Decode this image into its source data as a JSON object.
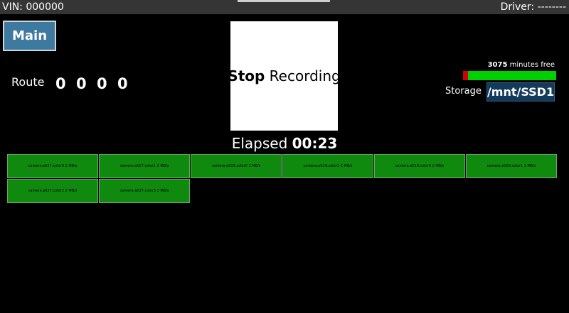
{
  "topbar": {
    "vin": "VIN: 000000",
    "driver": "Driver: --------"
  },
  "main_button": {
    "label": "Main"
  },
  "route": {
    "label": "Route",
    "digits": [
      "0",
      "0",
      "0",
      "0"
    ]
  },
  "recording": {
    "button_bold": "Stop",
    "button_rest": " Recording",
    "elapsed_label": "Elapsed ",
    "elapsed_time": "00:23"
  },
  "storage": {
    "minutes": "3075",
    "minutes_suffix": " minutes free",
    "label": "Storage",
    "path": "/mnt/SSD1",
    "used_fraction": 0.05,
    "colors": {
      "used": "#d40000",
      "free": "#00d000"
    }
  },
  "cameras": [
    {
      "label": "camera:a027:color0 2 MB/s"
    },
    {
      "label": "camera:a027:color1 2 MB/s"
    },
    {
      "label": "camera:a029:color0 2 MB/s"
    },
    {
      "label": "camera:a029:color1 2 MB/s"
    },
    {
      "label": "camera:a029:color0 2 MB/s"
    },
    {
      "label": "camera:a029:color1 1 MB/s"
    },
    {
      "label": "camera:a027:color2 2 MB/s"
    },
    {
      "label": "camera:a027:color3 2 MB/s"
    }
  ]
}
